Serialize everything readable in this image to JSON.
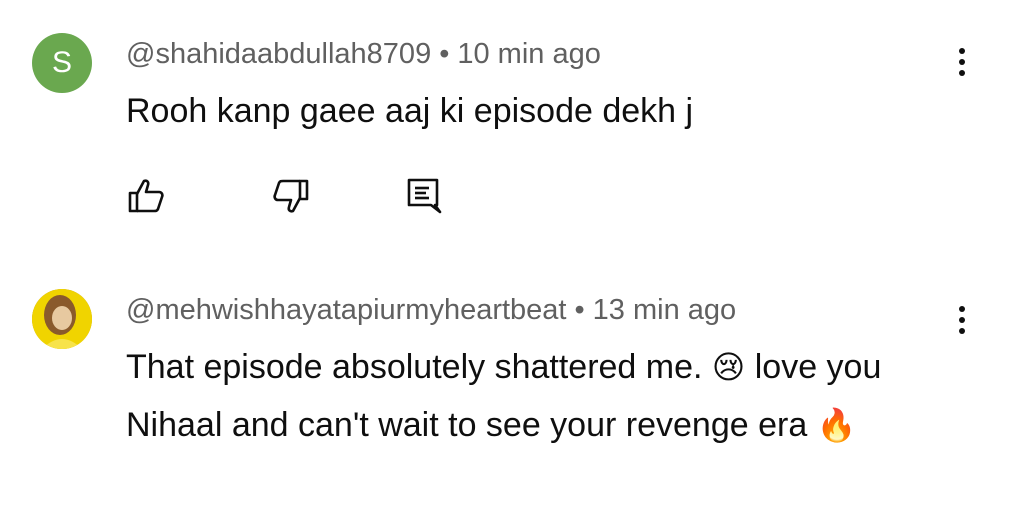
{
  "comments": [
    {
      "avatar_letter": "S",
      "avatar_color": "#6aa84f",
      "handle": "@shahidaabdullah8709",
      "time": "10 min ago",
      "text": "Rooh kanp gaee aaj ki episode dekh j"
    },
    {
      "avatar_type": "photo",
      "handle": "@mehwishhayatapiurmyheartbeat",
      "time": "13 min ago",
      "text_part1": "That episode absolutely shattered me.",
      "emoji1": "😢",
      "text_part2": "love you Nihaal and can't wait to see your revenge era",
      "emoji2": "🔥"
    }
  ],
  "separator": "•",
  "icons": {
    "like": "thumbs-up-icon",
    "dislike": "thumbs-down-icon",
    "reply": "reply-comment-icon",
    "menu": "more-vert-icon"
  }
}
